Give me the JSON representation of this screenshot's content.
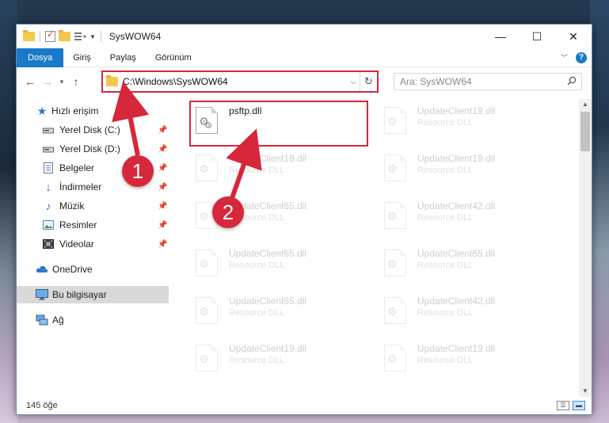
{
  "window": {
    "title": "SysWOW64",
    "controls": {
      "minimize": "—",
      "maximize": "☐",
      "close": "✕"
    }
  },
  "ribbon": {
    "file_tab": "Dosya",
    "tabs": [
      "Giriş",
      "Paylaş",
      "Görünüm"
    ],
    "help": "?"
  },
  "address": {
    "path": "C:\\Windows\\SysWOW64",
    "search_placeholder": "Ara: SysWOW64"
  },
  "sidebar": {
    "quick_access": "Hızlı erişim",
    "items": [
      {
        "label": "Yerel Disk (C:)",
        "icon": "drive-icon",
        "pinned": true
      },
      {
        "label": "Yerel Disk (D:)",
        "icon": "drive-icon",
        "pinned": true
      },
      {
        "label": "Belgeler",
        "icon": "documents-icon",
        "pinned": true
      },
      {
        "label": "İndirmeler",
        "icon": "downloads-icon",
        "pinned": true
      },
      {
        "label": "Müzik",
        "icon": "music-icon",
        "pinned": true
      },
      {
        "label": "Resimler",
        "icon": "pictures-icon",
        "pinned": true
      },
      {
        "label": "Videolar",
        "icon": "videos-icon",
        "pinned": true
      }
    ],
    "onedrive": "OneDrive",
    "this_pc": "Bu bilgisayar",
    "network": "Ağ"
  },
  "files": {
    "highlighted": {
      "name": "psftp.dll",
      "type": ""
    },
    "faded": [
      {
        "name": "UpdateClient19.dll",
        "type": "Resource DLL"
      },
      {
        "name": "UpdateClient19.dll",
        "type": "Resource DLL"
      },
      {
        "name": "UpdateClient19.dll",
        "type": "Resource DLL"
      },
      {
        "name": "UpdateClient65.dll",
        "type": "Resource DLL"
      },
      {
        "name": "UpdateClient42.dll",
        "type": "Resource DLL"
      },
      {
        "name": "UpdateClient65.dll",
        "type": "Resource DLL"
      },
      {
        "name": "UpdateClient65.dll",
        "type": "Resource DLL"
      },
      {
        "name": "UpdateClient65.dll",
        "type": "Resource DLL"
      },
      {
        "name": "UpdateClient42.dll",
        "type": "Resource DLL"
      },
      {
        "name": "UpdateClient19.dll",
        "type": "Resource DLL"
      },
      {
        "name": "UpdateClient19.dll",
        "type": "Resource DLL"
      }
    ]
  },
  "status": {
    "count": "145 öğe"
  },
  "annotations": {
    "step1": "1",
    "step2": "2",
    "color": "#d7273a"
  }
}
